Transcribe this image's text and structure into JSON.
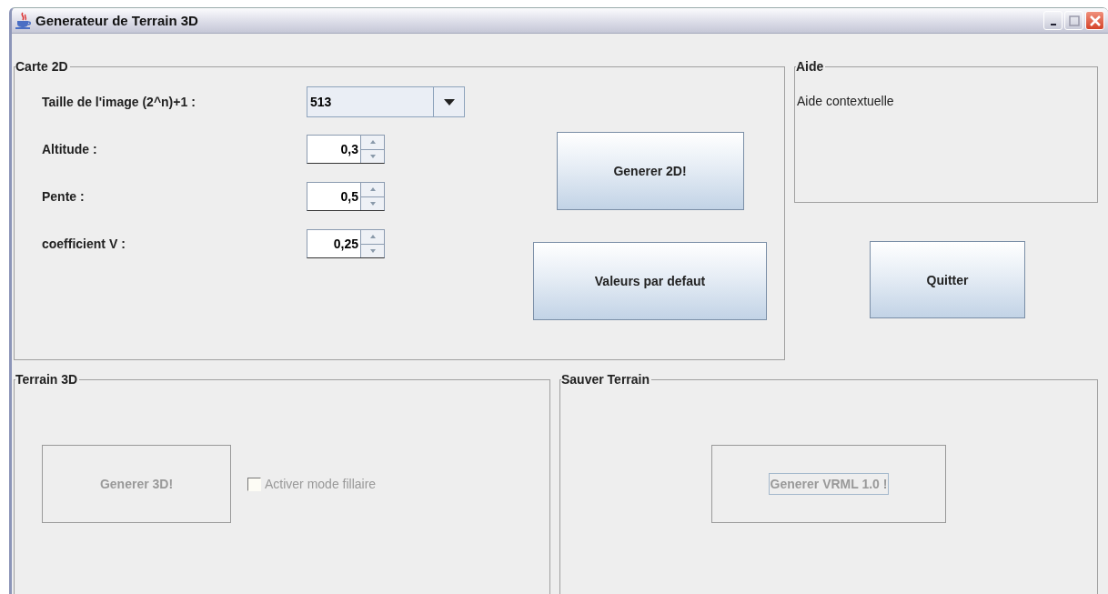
{
  "window": {
    "title": "Generateur de Terrain 3D"
  },
  "carte_2d": {
    "title": "Carte 2D",
    "fields": [
      {
        "kind": "combo",
        "label": "Taille de l'image (2^n)+1 :",
        "value": "513"
      },
      {
        "kind": "spinner",
        "label": "Altitude :",
        "value": "0,3"
      },
      {
        "kind": "spinner",
        "label": "Pente :",
        "value": "0,5"
      },
      {
        "kind": "spinner",
        "label": "coefficient V :",
        "value": "0,25"
      }
    ],
    "buttons": [
      {
        "label": "Generer 2D!",
        "disabled": false
      },
      {
        "label": "Valeurs par defaut",
        "disabled": false
      }
    ]
  },
  "aide": {
    "title": "Aide",
    "text": "Aide contextuelle"
  },
  "quit_button": {
    "label": "Quitter",
    "disabled": false
  },
  "terrain_3d": {
    "title": "Terrain 3D",
    "button": {
      "label": "Generer 3D!",
      "disabled": true
    },
    "checkbox": {
      "label": "Activer mode fillaire",
      "checked": false,
      "disabled": true
    }
  },
  "sauver_terrain": {
    "title": "Sauver Terrain",
    "button": {
      "label": "Generer VRML 1.0 !",
      "disabled": true,
      "focused": true
    }
  }
}
